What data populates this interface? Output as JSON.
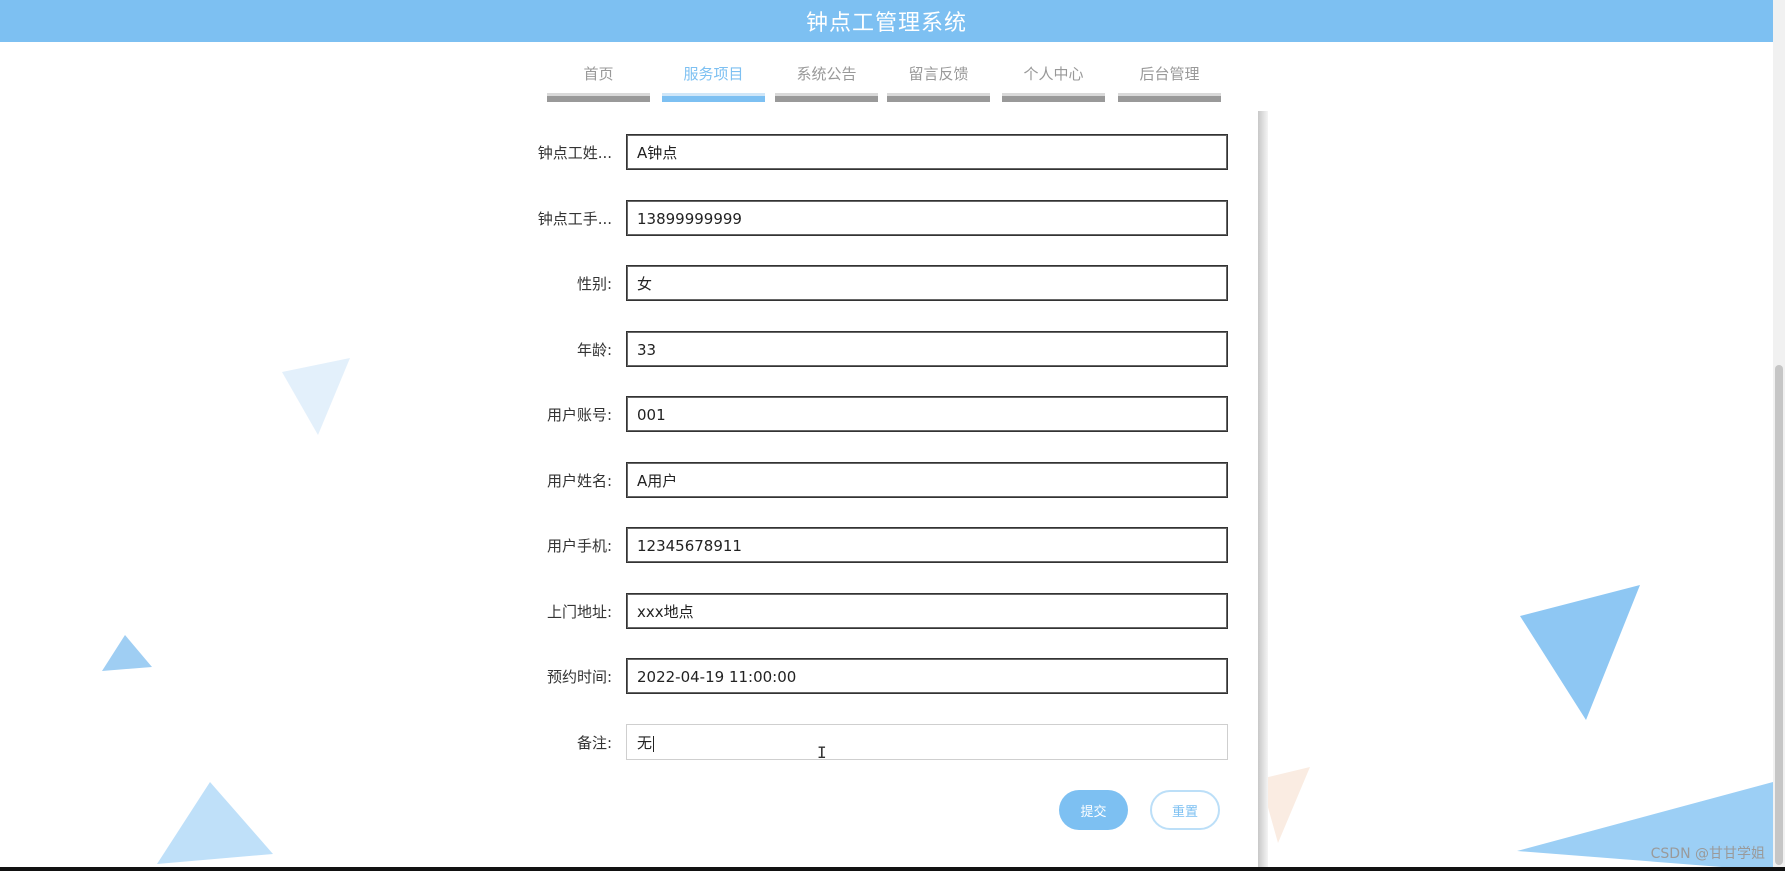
{
  "app": {
    "title": "钟点工管理系统"
  },
  "nav": {
    "items": [
      {
        "label": "首页",
        "active": false
      },
      {
        "label": "服务项目",
        "active": true
      },
      {
        "label": "系统公告",
        "active": false
      },
      {
        "label": "留言反馈",
        "active": false
      },
      {
        "label": "个人中心",
        "active": false
      },
      {
        "label": "后台管理",
        "active": false
      }
    ]
  },
  "form": {
    "fields": [
      {
        "label": "钟点工姓...",
        "value": "A钟点"
      },
      {
        "label": "钟点工手...",
        "value": "13899999999"
      },
      {
        "label": "性别:",
        "value": "女"
      },
      {
        "label": "年龄:",
        "value": "33"
      },
      {
        "label": "用户账号:",
        "value": "001"
      },
      {
        "label": "用户姓名:",
        "value": "A用户"
      },
      {
        "label": "用户手机:",
        "value": "12345678911"
      },
      {
        "label": "上门地址:",
        "value": "xxx地点"
      },
      {
        "label": "预约时间:",
        "value": "2022-04-19 11:00:00"
      },
      {
        "label": "备注:",
        "value": "无"
      }
    ],
    "submit_label": "提交",
    "reset_label": "重置"
  },
  "watermark": "CSDN @甘甘学姐",
  "colors": {
    "accent": "#7dc0f2",
    "triangle_light": "#cfe6f8",
    "triangle_mid": "#a9d4f6"
  }
}
